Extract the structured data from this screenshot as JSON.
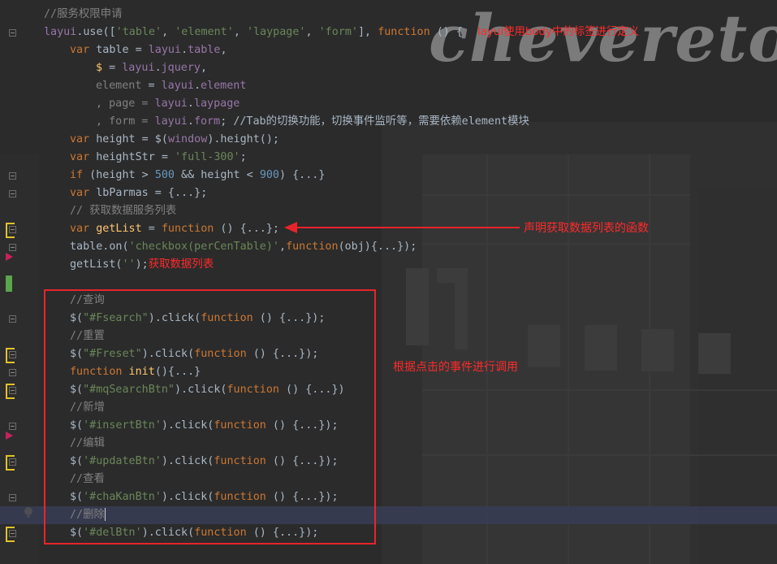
{
  "watermark": "chevereto",
  "annotations": {
    "list_fn": "声明获取数据列表的函数",
    "get_list": "获取数据列表",
    "event_calls": "根据点击的事件进行调用",
    "overlay_comment": "layui使用body中的标签进行定义"
  },
  "code": {
    "l0": "//服务权限申请",
    "l1_a": "layui",
    "l1_b": ".use([",
    "l1_c": "'table'",
    "l1_d": ", ",
    "l1_e": "'element'",
    "l1_f": ", ",
    "l1_g": "'laypage'",
    "l1_h": ", ",
    "l1_i": "'form'",
    "l1_j": "], ",
    "l1_k": "function",
    "l1_l": " () {",
    "l2_a": "var",
    "l2_b": " table = ",
    "l2_c": "layui",
    "l2_d": ".",
    "l2_e": "table",
    "l2_f": ",",
    "l3_a": "$",
    "l3_b": " = ",
    "l3_c": "layui",
    "l3_d": ".",
    "l3_e": "jquery",
    "l3_f": ",",
    "l4_a": "element",
    "l4_b": " = ",
    "l4_c": "layui",
    "l4_d": ".",
    "l4_e": "element",
    "l5_a": ", page = ",
    "l5_b": "layui",
    "l5_c": ".",
    "l5_d": "laypage",
    "l6_a": ", form = ",
    "l6_b": "layui",
    "l6_c": ".",
    "l6_d": "form",
    "l6_e": "; ",
    "l6_f": "//Tab的切换功能，切换事件监听等，需要依赖element模块",
    "l7_a": "var",
    "l7_b": " height = $(",
    "l7_c": "window",
    "l7_d": ").height();",
    "l8_a": "var",
    "l8_b": " heightStr = ",
    "l8_c": "'full-300'",
    "l8_d": ";",
    "l9_a": "if",
    "l9_b": " (height > ",
    "l9_c": "500",
    "l9_d": " && height < ",
    "l9_e": "900",
    "l9_f": ") {...}",
    "l10_a": "var",
    "l10_b": " lbParmas = {...};",
    "l11": "// 获取数据服务列表",
    "l12_a": "var",
    "l12_b": " getList",
    "l12_c": " = ",
    "l12_d": "function",
    "l12_e": " () {...};",
    "l13_a": "table.on(",
    "l13_b": "'checkbox(perCenTable)'",
    "l13_c": ",",
    "l13_d": "function",
    "l13_e": "(obj){...});",
    "l14_a": "getList(",
    "l14_b": "''",
    "l14_c": ");",
    "l16": "//查询",
    "l17_a": "$(",
    "l17_b": "\"#Fsearch\"",
    "l17_c": ").click(",
    "l17_d": "function",
    "l17_e": " () {...});",
    "l18": "//重置",
    "l19_a": "$(",
    "l19_b": "\"#Freset\"",
    "l19_c": ").click(",
    "l19_d": "function",
    "l19_e": " () {...});",
    "l20_a": "function",
    "l20_b": " init",
    "l20_c": "(){...}",
    "l21_a": "$(",
    "l21_b": "\"#mqSearchBtn\"",
    "l21_c": ").click(",
    "l21_d": "function",
    "l21_e": " () {...})",
    "l22": "//新增",
    "l23_a": "$(",
    "l23_b": "'#insertBtn'",
    "l23_c": ").click(",
    "l23_d": "function",
    "l23_e": " () {...});",
    "l24": "//编辑",
    "l25_a": "$(",
    "l25_b": "'#updateBtn'",
    "l25_c": ").click(",
    "l25_d": "function",
    "l25_e": " () {...});",
    "l26": "//查看",
    "l27_a": "$(",
    "l27_b": "'#chaKanBtn'",
    "l27_c": ").click(",
    "l27_d": "function",
    "l27_e": " () {...});",
    "l28": "//删除",
    "l29_a": "$(",
    "l29_b": "'#delBtn'",
    "l29_c": ").click(",
    "l29_d": "function",
    "l29_e": " () {...});"
  }
}
